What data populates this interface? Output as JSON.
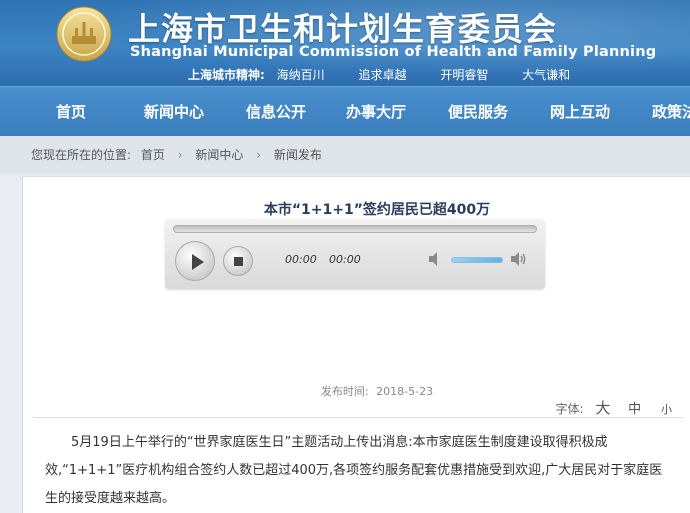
{
  "header": {
    "title_cn": "上海市卫生和计划生育委员会",
    "title_en": "Shanghai Municipal Commission of Health and Family Planning",
    "spirit_label": "上海城市精神:",
    "spirit_items": [
      "海纳百川",
      "追求卓越",
      "开明睿智",
      "大气谦和"
    ],
    "colors": {
      "header_blue": "#2f73b3",
      "nav_blue": "#3a7dbd"
    }
  },
  "nav": {
    "items": [
      "首页",
      "新闻中心",
      "信息公开",
      "办事大厅",
      "便民服务",
      "网上互动",
      "政策法"
    ]
  },
  "breadcrumb": {
    "prefix": "您现在所在的位置:",
    "items": [
      "首页",
      "新闻中心",
      "新闻发布"
    ]
  },
  "article": {
    "title": "本市“1+1+1”签约居民已超400万",
    "player": {
      "current_time": "00:00",
      "duration": "00:00",
      "icons": [
        "play-icon",
        "stop-icon",
        "volume-mute-icon",
        "volume-up-icon"
      ]
    },
    "publish_label": "发布时间:",
    "publish_date": "2018-5-23",
    "font_label": "字体:",
    "font_options": [
      "大",
      "中",
      "小"
    ],
    "body": "5月19日上午举行的“世界家庭医生日”主题活动上传出消息:本市家庭医生制度建设取得积极成效,“1+1+1”医疗机构组合签约人数已超过400万,各项签约服务配套优惠措施受到欢迎,广大居民对于家庭医生的接受度越来越高。"
  }
}
